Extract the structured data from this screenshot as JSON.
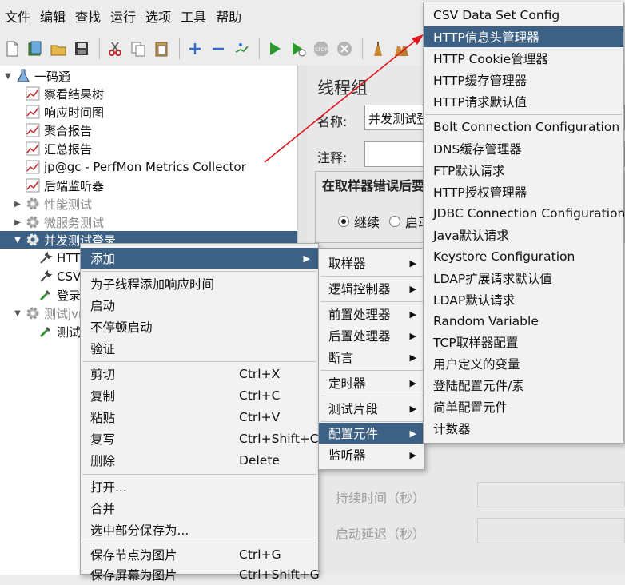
{
  "menubar": [
    "文件",
    "编辑",
    "查找",
    "运行",
    "选项",
    "工具",
    "帮助"
  ],
  "tree": {
    "root": "一码通",
    "listeners": [
      "察看结果树",
      "响应时间图",
      "聚合报告",
      "汇总报告",
      "jp@gc - PerfMon Metrics Collector",
      "后端监听器"
    ],
    "groups": [
      {
        "label": "性能测试",
        "disabled": true
      },
      {
        "label": "微服务测试",
        "disabled": true
      },
      {
        "label": "并发测试登录",
        "selected": true,
        "children": [
          "HTTP",
          "CSV",
          "登录"
        ]
      },
      {
        "label": "测试jvm",
        "disabled": true,
        "children": [
          "测试"
        ]
      }
    ]
  },
  "panel": {
    "title": "线程组",
    "name_label": "名称:",
    "name_value": "并发测试登录",
    "comment_label": "注释:",
    "on_error_label": "在取样器错误后要",
    "radio_continue": "继续",
    "radio_start": "启动",
    "duration_label": "持续时间（秒）",
    "delay_label": "启动延迟（秒）"
  },
  "context_menu": {
    "add": "添加",
    "group1": [
      "为子线程添加响应时间",
      "启动",
      "不停顿启动",
      "验证"
    ],
    "edit": [
      {
        "label": "剪切",
        "shortcut": "Ctrl+X"
      },
      {
        "label": "复制",
        "shortcut": "Ctrl+C"
      },
      {
        "label": "粘贴",
        "shortcut": "Ctrl+V"
      },
      {
        "label": "复写",
        "shortcut": "Ctrl+Shift+C"
      },
      {
        "label": "删除",
        "shortcut": "Delete"
      }
    ],
    "file": [
      "打开...",
      "合并",
      "选中部分保存为..."
    ],
    "save": [
      {
        "label": "保存节点为图片",
        "shortcut": "Ctrl+G"
      },
      {
        "label": "保存屏幕为图片",
        "shortcut": "Ctrl+Shift+G"
      }
    ]
  },
  "add_submenu": [
    "取样器",
    "逻辑控制器",
    "前置处理器",
    "后置处理器",
    "断言",
    "定时器",
    "测试片段",
    "配置元件",
    "监听器"
  ],
  "config_submenu": [
    "CSV Data Set Config",
    "HTTP信息头管理器",
    "HTTP Cookie管理器",
    "HTTP缓存管理器",
    "HTTP请求默认值",
    "Bolt Connection Configuration",
    "DNS缓存管理器",
    "FTP默认请求",
    "HTTP授权管理器",
    "JDBC Connection Configuration",
    "Java默认请求",
    "Keystore Configuration",
    "LDAP扩展请求默认值",
    "LDAP默认请求",
    "Random Variable",
    "TCP取样器配置",
    "用户定义的变量",
    "登陆配置元件/素",
    "简单配置元件",
    "计数器"
  ],
  "colors": {
    "highlight": "#3d6185",
    "arrow": "#e0141b"
  },
  "icons": {
    "toolbar": [
      "new-icon",
      "templates-icon",
      "open-icon",
      "save-icon",
      "cut-icon",
      "copy-icon",
      "paste-icon",
      "expand-icon",
      "collapse-icon",
      "toggle-icon",
      "start-icon",
      "start-no-pause-icon",
      "stop-icon",
      "shutdown-icon",
      "clear-icon",
      "clear-all-icon"
    ]
  }
}
